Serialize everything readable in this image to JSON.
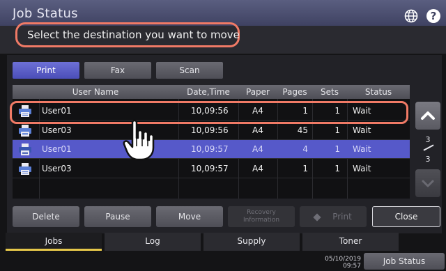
{
  "header": {
    "title": "Job Status"
  },
  "message": "Select the destination you want to move",
  "categories": [
    {
      "label": "Print",
      "active": true
    },
    {
      "label": "Fax",
      "active": false
    },
    {
      "label": "Scan",
      "active": false
    }
  ],
  "table": {
    "columns": [
      "User Name",
      "Date,Time",
      "Paper",
      "Pages",
      "Sets",
      "Status"
    ],
    "rows": [
      {
        "user": "User01",
        "datetime": "10,09:56",
        "paper": "A4",
        "pages": "1",
        "sets": "1",
        "status": "Wait",
        "selected": false
      },
      {
        "user": "User03",
        "datetime": "10,09:56",
        "paper": "A4",
        "pages": "45",
        "sets": "1",
        "status": "Wait",
        "selected": false
      },
      {
        "user": "User01",
        "datetime": "10,09:57",
        "paper": "A4",
        "pages": "4",
        "sets": "1",
        "status": "Wait",
        "selected": true
      },
      {
        "user": "User03",
        "datetime": "10,09:57",
        "paper": "A4",
        "pages": "1",
        "sets": "1",
        "status": "Wait",
        "selected": false
      }
    ]
  },
  "pagination": {
    "current": "3",
    "total": "3"
  },
  "actions": {
    "delete": "Delete",
    "pause": "Pause",
    "move": "Move",
    "recovery_line1": "Recovery",
    "recovery_line2": "Information",
    "print": "Print",
    "close": "Close"
  },
  "bottom_tabs": [
    {
      "label": "Jobs",
      "active": true
    },
    {
      "label": "Log",
      "active": false
    },
    {
      "label": "Supply",
      "active": false
    },
    {
      "label": "Toner",
      "active": false
    }
  ],
  "footer": {
    "date": "05/10/2019",
    "time": "09:57",
    "job_status": "Job Status"
  },
  "colors": {
    "accent": "#5659c9",
    "highlight": "#f07a66",
    "tab_indicator": "#e6c84a"
  },
  "icons": [
    "globe-icon",
    "help-icon",
    "printer-icon",
    "chevron-up-icon",
    "chevron-down-icon",
    "hand-pointer-icon"
  ]
}
